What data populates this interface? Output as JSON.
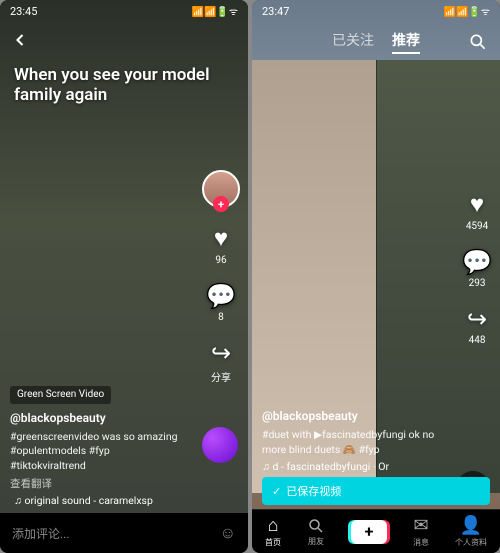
{
  "left": {
    "status": {
      "time": "23:45",
      "signal_icons": "📶📶🔋ᯤ"
    },
    "overlay_text": "When you see your model family again",
    "badge": "Green Screen Video",
    "username": "@blackopsbeauty",
    "caption": "#greenscreenvideo was so amazing #opulentmodels #fyp #tiktokviraltrend",
    "translate_hint": "查看翻译",
    "music": "♫ original sound - caramelxsp",
    "rail": {
      "like_count": "96",
      "comment_count": "8",
      "share_label": "分享"
    },
    "comment_placeholder": "添加评论..."
  },
  "right": {
    "status": {
      "time": "23:47",
      "signal_icons": "📶📶🔋ᯤ"
    },
    "tabs": {
      "follow": "已关注",
      "recommend": "推荐"
    },
    "username": "@blackopsbeauty",
    "caption": "#duet with ▶fascinatedbyfungi  ok no more blind duets 🙈 #fyp",
    "music": "♫ d - fascinatedbyfungi · Or",
    "rail": {
      "like_count": "4594",
      "comment_count": "293",
      "share_count": "448"
    },
    "saved_banner": "已保存视频",
    "nav": {
      "home": "首页",
      "discover": "朋友",
      "inbox": "消息",
      "me": "个人资料"
    }
  }
}
